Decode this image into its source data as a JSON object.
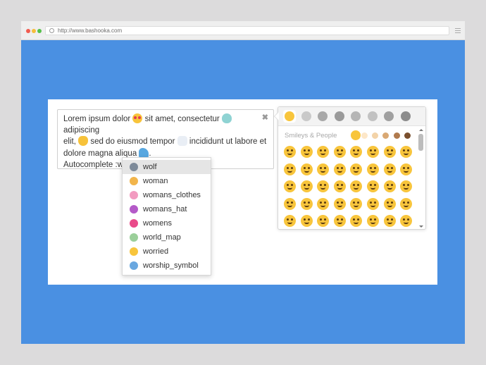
{
  "browser": {
    "url": "http://www.bashooka.com"
  },
  "editor": {
    "line1a": "Lorem ipsum dolor",
    "line1b": "sit amet, consectetur",
    "line1c": "adipiscing",
    "line2a": "elit,",
    "line2b": "sed do eiusmod tempor",
    "line2c": "incididunt ut labore et",
    "line3a": "dolore magna aliqua",
    "line3b": ".",
    "line4": "Autocomplete :wo",
    "clear_icon": "close-icon"
  },
  "autocomplete": {
    "items": [
      {
        "label": "wolf",
        "icon": "wolf-icon",
        "color": "#7d8a99",
        "selected": true
      },
      {
        "label": "woman",
        "icon": "woman-icon",
        "color": "#f2b54b"
      },
      {
        "label": "womans_clothes",
        "icon": "womans-clothes-icon",
        "color": "#f29bc0"
      },
      {
        "label": "womans_hat",
        "icon": "womans-hat-icon",
        "color": "#b45ac8"
      },
      {
        "label": "womens",
        "icon": "womens-icon",
        "color": "#e94b8a"
      },
      {
        "label": "world_map",
        "icon": "world-map-icon",
        "color": "#9bcf9a"
      },
      {
        "label": "worried",
        "icon": "worried-icon",
        "color": "#f8c53c"
      },
      {
        "label": "worship_symbol",
        "icon": "worship-symbol-icon",
        "color": "#6aa8e0"
      }
    ]
  },
  "picker": {
    "category_title": "Smileys & People",
    "tabs": [
      {
        "icon": "smiley-tab-icon",
        "color": "#f8c53c",
        "active": true
      },
      {
        "icon": "animals-tab-icon",
        "color": "#c9c9c9"
      },
      {
        "icon": "food-tab-icon",
        "color": "#a8a8a8"
      },
      {
        "icon": "activity-tab-icon",
        "color": "#9a9a9a"
      },
      {
        "icon": "travel-tab-icon",
        "color": "#b5b5b5"
      },
      {
        "icon": "objects-tab-icon",
        "color": "#c2c2c2"
      },
      {
        "icon": "symbols-tab-icon",
        "color": "#a0a0a0"
      },
      {
        "icon": "flags-tab-icon",
        "color": "#8c8c8c"
      }
    ],
    "skin_tones": [
      "#f8c53c",
      "#fde7c8",
      "#f3d3a8",
      "#d9a873",
      "#b07a4d",
      "#7a4f2e"
    ],
    "emoji_rows": [
      [
        "grinning",
        "grimacing",
        "grin",
        "joy",
        "smiley",
        "smile",
        "sweat-smile",
        "laughing"
      ],
      [
        "innocent",
        "wink",
        "blush",
        "slightly-smiling",
        "upside-down",
        "relaxed",
        "yum",
        "relieved"
      ],
      [
        "heart-eyes",
        "kissing-heart",
        "kissing",
        "kissing-smiling-eyes",
        "kissing-closed-eyes",
        "stuck-out-tongue-winking",
        "stuck-out-tongue-closed-eyes",
        "stuck-out-tongue"
      ],
      [
        "money-mouth",
        "nerd",
        "sunglasses",
        "hugging",
        "smirk",
        "no-mouth",
        "neutral",
        "expressionless"
      ],
      [
        "unamused",
        "rolling-eyes",
        "thinking",
        "flushed",
        "disappointed",
        "worried",
        "angry",
        "rage"
      ]
    ]
  }
}
